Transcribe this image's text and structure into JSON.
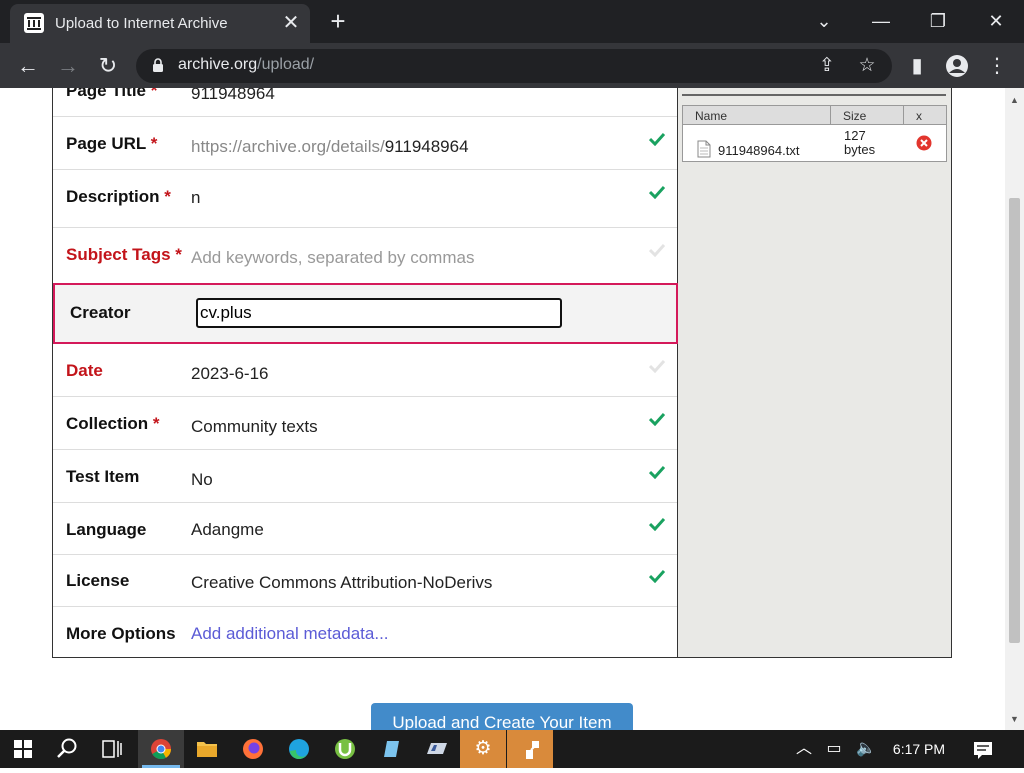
{
  "browser": {
    "tab_title": "Upload to Internet Archive",
    "url_domain": "archive.org",
    "url_path": "/upload/"
  },
  "form": {
    "rows": [
      {
        "label": "Page Title",
        "required": "*",
        "value": "911948964"
      },
      {
        "label": "Page URL",
        "required": "*",
        "value_prefix": "https://archive.org/details/",
        "value": "911948964"
      },
      {
        "label": "Description",
        "required": "*",
        "value": "n"
      },
      {
        "label": "Subject Tags",
        "required": "*",
        "placeholder": "Add keywords, separated by commas"
      },
      {
        "label": "Creator",
        "value": "cv.plus"
      },
      {
        "label": "Date",
        "value": "2023-6-16"
      },
      {
        "label": "Collection",
        "required": "*",
        "value": "Community texts"
      },
      {
        "label": "Test Item",
        "value": "No"
      },
      {
        "label": "Language",
        "value": "Adangme"
      },
      {
        "label": "License",
        "value": "Creative Commons Attribution-NoDerivs"
      },
      {
        "label": "More Options",
        "link": "Add additional metadata..."
      }
    ],
    "submit_label": "Upload and Create Your Item"
  },
  "files": {
    "headers": {
      "name": "Name",
      "size": "Size",
      "remove": "x"
    },
    "items": [
      {
        "name": "911948964.txt",
        "size_num": "127",
        "size_unit": "bytes"
      }
    ]
  },
  "taskbar": {
    "clock": "6:17 PM"
  },
  "colors": {
    "required_red": "#c3141a",
    "check_green": "#1aa260",
    "focus_border": "#d4195a",
    "button_blue": "#428bca"
  }
}
